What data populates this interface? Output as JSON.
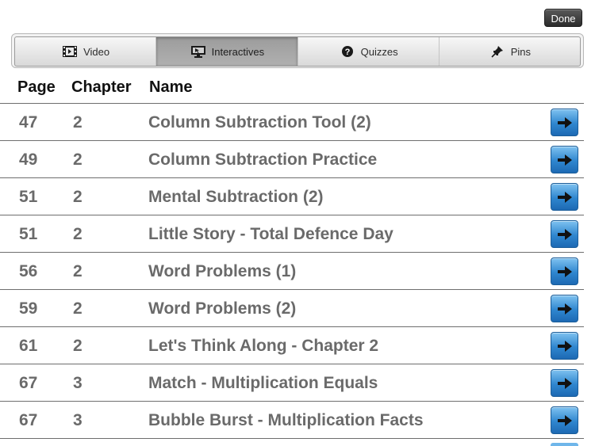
{
  "toolbar": {
    "done_label": "Done"
  },
  "tabs": [
    {
      "label": "Video",
      "icon": "film-icon",
      "selected": false
    },
    {
      "label": "Interactives",
      "icon": "monitor-icon",
      "selected": true
    },
    {
      "label": "Quizzes",
      "icon": "question-icon",
      "selected": false
    },
    {
      "label": "Pins",
      "icon": "pin-icon",
      "selected": false
    }
  ],
  "table": {
    "headers": {
      "page": "Page",
      "chapter": "Chapter",
      "name": "Name"
    },
    "rows": [
      {
        "page": "47",
        "chapter": "2",
        "name": "Column Subtraction Tool (2)"
      },
      {
        "page": "49",
        "chapter": "2",
        "name": "Column Subtraction Practice"
      },
      {
        "page": "51",
        "chapter": "2",
        "name": "Mental Subtraction (2)"
      },
      {
        "page": "51",
        "chapter": "2",
        "name": "Little Story - Total Defence Day"
      },
      {
        "page": "56",
        "chapter": "2",
        "name": "Word Problems (1)"
      },
      {
        "page": "59",
        "chapter": "2",
        "name": "Word Problems (2)"
      },
      {
        "page": "61",
        "chapter": "2",
        "name": "Let's Think Along - Chapter 2"
      },
      {
        "page": "67",
        "chapter": "3",
        "name": "Match - Multiplication Equals"
      },
      {
        "page": "67",
        "chapter": "3",
        "name": "Bubble Burst - Multiplication Facts"
      }
    ]
  },
  "colors": {
    "go_button": "#2f86cf",
    "done_button": "#3a3a3a",
    "row_text": "#6a6a6a"
  }
}
